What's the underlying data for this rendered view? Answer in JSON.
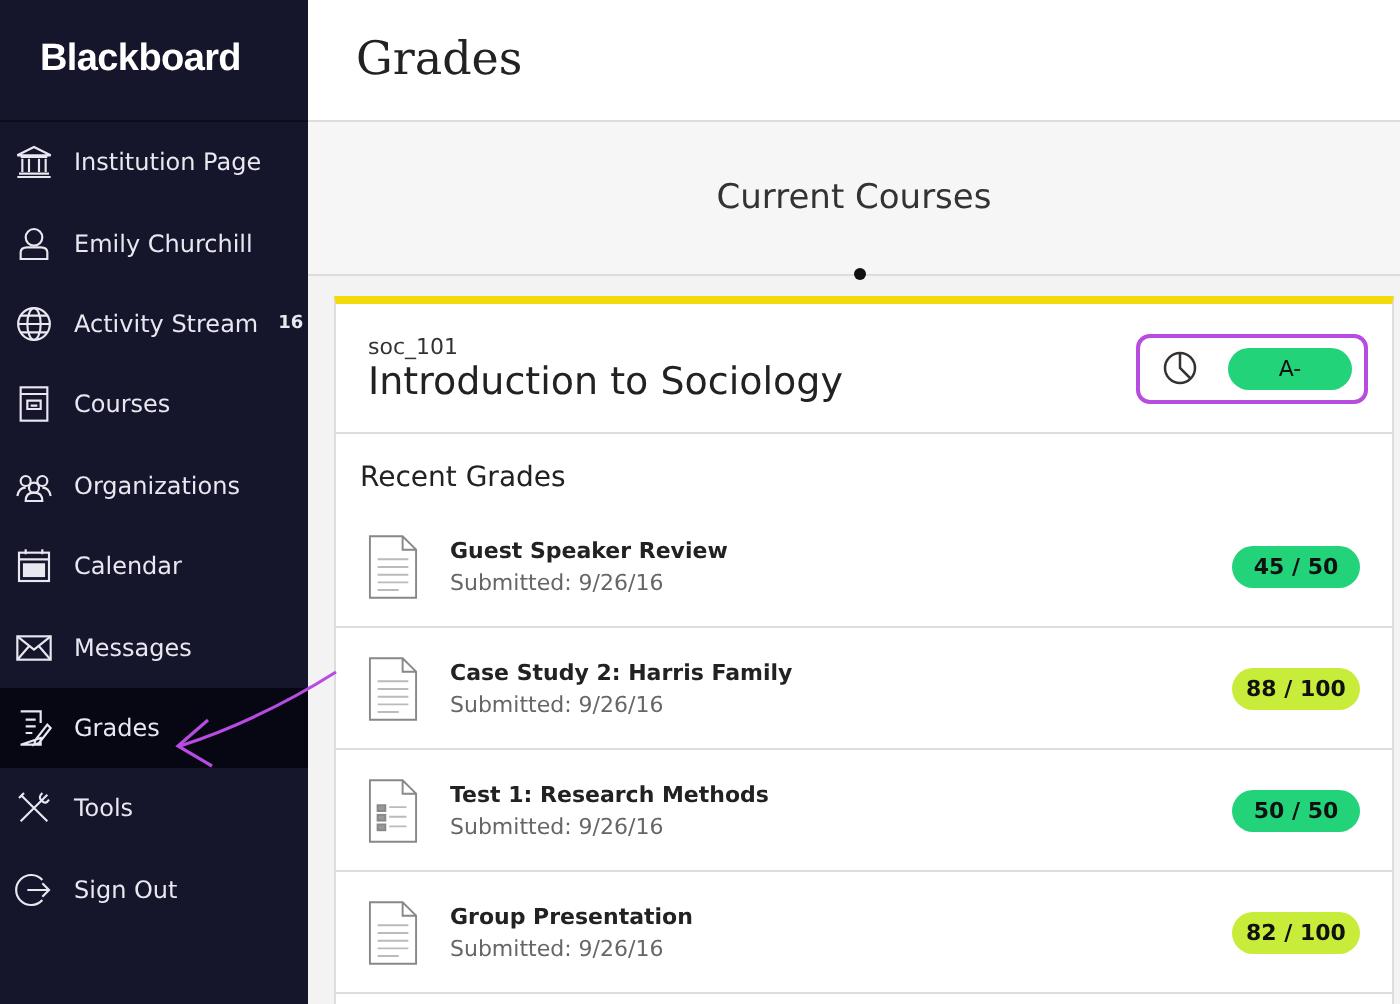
{
  "sidebar": {
    "logo": "Blackboard",
    "items": [
      {
        "label": "Institution Page",
        "selected": false
      },
      {
        "label": "Emily Churchill",
        "selected": false
      },
      {
        "label": "Activity Stream",
        "selected": false,
        "badge": "16"
      },
      {
        "label": "Courses",
        "selected": false
      },
      {
        "label": "Organizations",
        "selected": false
      },
      {
        "label": "Calendar",
        "selected": false
      },
      {
        "label": "Messages",
        "selected": false
      },
      {
        "label": "Grades",
        "selected": true
      },
      {
        "label": "Tools",
        "selected": false
      },
      {
        "label": "Sign Out",
        "selected": false
      }
    ]
  },
  "page": {
    "title": "Grades",
    "section": "Current Courses"
  },
  "course": {
    "code": "soc_101",
    "name": "Introduction to Sociology",
    "overall_grade": "A-",
    "heading": "Recent Grades",
    "grades": [
      {
        "kind": "document",
        "title": "Guest Speaker Review",
        "submitted": "Submitted: 9/26/16",
        "score": "45 / 50",
        "color": "#22d37a"
      },
      {
        "kind": "document",
        "title": "Case Study 2: Harris Family",
        "submitted": "Submitted: 9/26/16",
        "score": "88 / 100",
        "color": "#c8ec3a"
      },
      {
        "kind": "test",
        "title": "Test 1: Research Methods",
        "submitted": "Submitted: 9/26/16",
        "score": "50 / 50",
        "color": "#22d37a"
      },
      {
        "kind": "document",
        "title": "Group Presentation",
        "submitted": "Submitted: 9/26/16",
        "score": "82 / 100",
        "color": "#c8ec3a"
      }
    ]
  }
}
